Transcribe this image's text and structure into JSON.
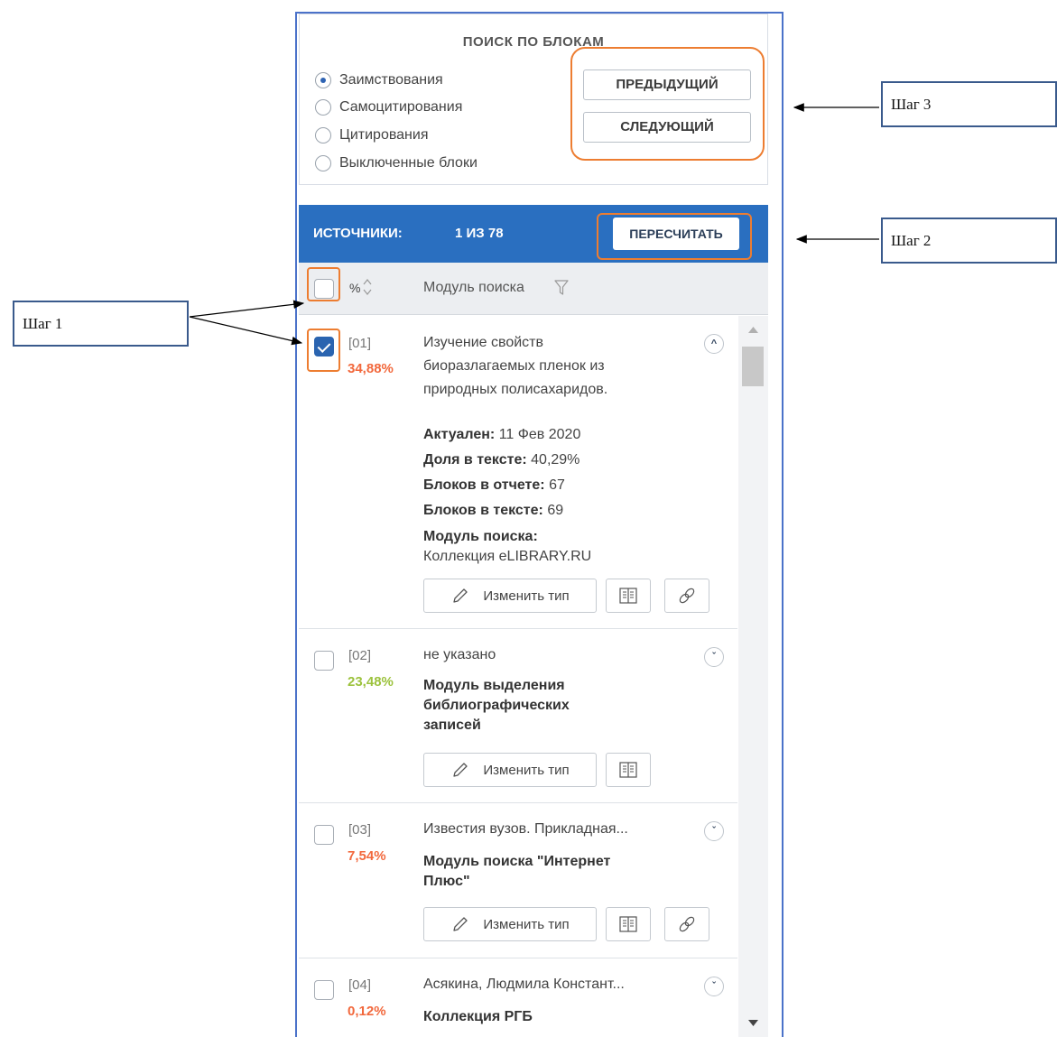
{
  "search": {
    "title": "ПОИСК ПО БЛОКАМ",
    "options": [
      {
        "label": "Заимствования",
        "checked": true
      },
      {
        "label": "Самоцитирования",
        "checked": false
      },
      {
        "label": "Цитирования",
        "checked": false
      },
      {
        "label": "Выключенные блоки",
        "checked": false
      }
    ],
    "prev_label": "ПРЕДЫДУЩИЙ",
    "next_label": "СЛЕДУЮЩИЙ"
  },
  "sources_bar": {
    "label": "ИСТОЧНИКИ:",
    "count": "1 ИЗ 78",
    "recalc_label": "ПЕРЕСЧИТАТЬ",
    "color": "#2a6fc0"
  },
  "columns": {
    "percent": "%",
    "module": "Модуль поиска"
  },
  "sources": [
    {
      "num": "[01]",
      "pct": "34,88%",
      "pct_color": "red",
      "checked": true,
      "expanded": true,
      "title_lines": [
        "Изучение свойств",
        "биоразлагаемых пленок из",
        "природных полисахаридов."
      ],
      "meta": [
        {
          "label": "Актуален:",
          "value": "11 Фев 2020"
        },
        {
          "label": "Доля в тексте:",
          "value": "40,29%"
        },
        {
          "label": "Блоков в отчете:",
          "value": "67"
        },
        {
          "label": "Блоков в тексте:",
          "value": "69"
        },
        {
          "label": "Модуль поиска:",
          "value": ""
        }
      ],
      "module_value": "Коллекция eLIBRARY.RU",
      "change_type_label": "Изменить тип"
    },
    {
      "num": "[02]",
      "pct": "23,48%",
      "pct_color": "green",
      "checked": false,
      "expanded": false,
      "title": "не указано",
      "module_lines": [
        "Модуль выделения",
        "библиографических",
        "записей"
      ],
      "change_type_label": "Изменить тип"
    },
    {
      "num": "[03]",
      "pct": "7,54%",
      "pct_color": "red",
      "checked": false,
      "expanded": false,
      "title": "Известия вузов. Прикладная...",
      "module_lines": [
        "Модуль поиска \"Интернет",
        "Плюс\""
      ],
      "change_type_label": "Изменить тип"
    },
    {
      "num": "[04]",
      "pct": "0,12%",
      "pct_color": "red",
      "checked": false,
      "expanded": false,
      "title": "Асякина, Людмила Констант...",
      "module_lines": [
        "Коллекция РГБ"
      ]
    }
  ],
  "callouts": {
    "step1": "Шаг 1",
    "step2": "Шаг 2",
    "step3": "Шаг 3"
  },
  "colors": {
    "accent": "#2a6fc0",
    "highlight": "#ed7d31",
    "pct_red": "#f2683c",
    "pct_green": "#9cc23d"
  }
}
